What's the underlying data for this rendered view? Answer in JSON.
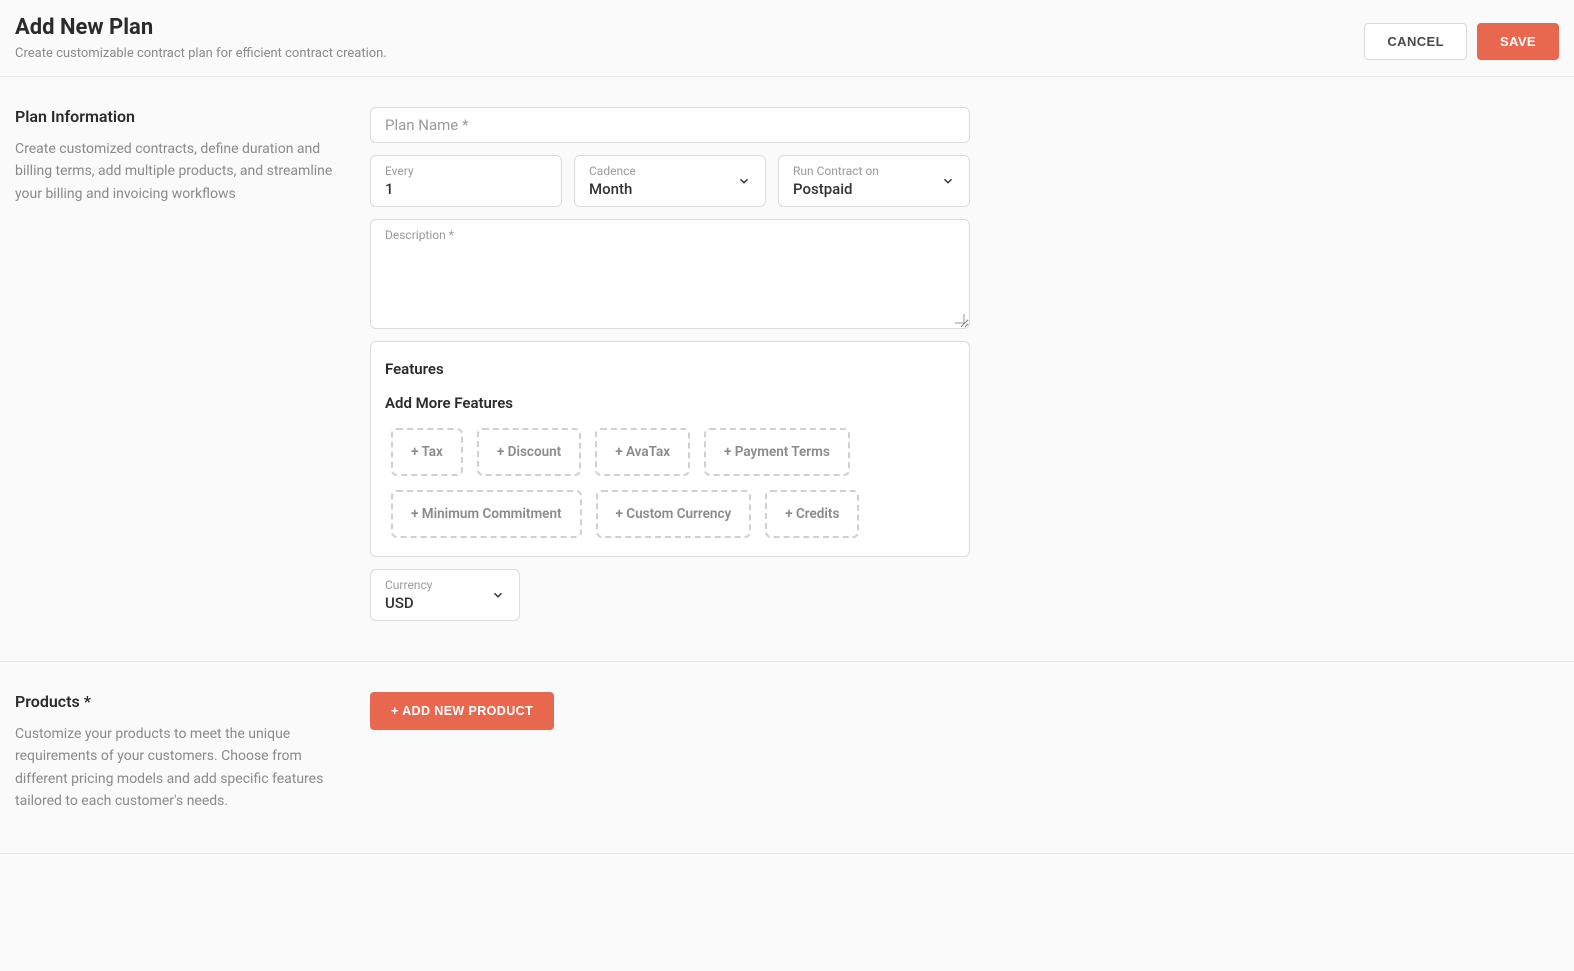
{
  "header": {
    "title": "Add New Plan",
    "subtitle": "Create customizable contract plan for efficient contract creation.",
    "cancel": "CANCEL",
    "save": "SAVE"
  },
  "planInfo": {
    "title": "Plan Information",
    "desc": "Create customized contracts, define duration and billing terms, add multiple products, and streamline your billing and invoicing workflows",
    "planNameLabel": "Plan Name *",
    "everyLabel": "Every",
    "everyValue": "1",
    "cadenceLabel": "Cadence",
    "cadenceValue": "Month",
    "runContractLabel": "Run Contract on",
    "runContractValue": "Postpaid",
    "descriptionLabel": "Description *",
    "featuresTitle": "Features",
    "featuresSub": "Add More Features",
    "chips": {
      "tax": "+ Tax",
      "discount": "+ Discount",
      "avatax": "+ AvaTax",
      "paymentTerms": "+ Payment Terms",
      "minCommit": "+ Minimum Commitment",
      "customCurrency": "+ Custom Currency",
      "credits": "+ Credits"
    },
    "currencyLabel": "Currency",
    "currencyValue": "USD"
  },
  "products": {
    "title": "Products *",
    "desc": "Customize your products to meet the unique requirements of your customers. Choose from different pricing models and add specific features tailored to each customer's needs.",
    "addButton": "+ ADD NEW PRODUCT"
  }
}
